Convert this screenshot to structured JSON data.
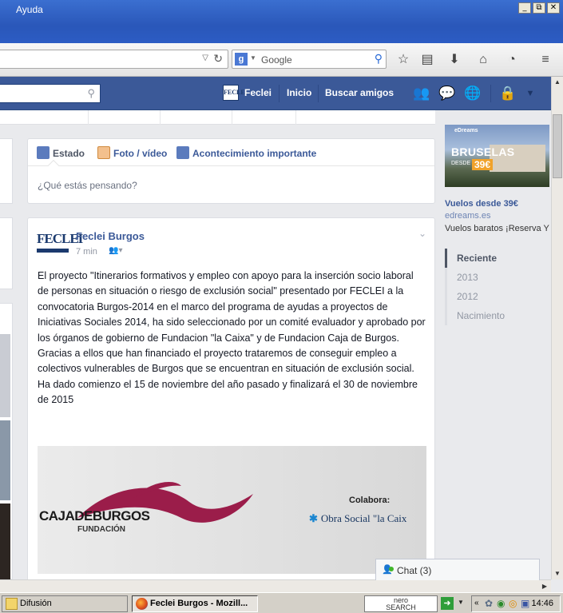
{
  "browser": {
    "menu": {
      "first_fragment": "",
      "help": "Ayuda"
    },
    "window_buttons": [
      "_",
      "⧉",
      "✕"
    ],
    "search": {
      "engine_letter": "g",
      "placeholder": "Google"
    }
  },
  "facebook": {
    "topbar": {
      "page_name": "Feclei",
      "home": "Inicio",
      "find_friends": "Buscar amigos"
    },
    "composer": {
      "tabs": [
        {
          "label": "Estado"
        },
        {
          "label": "Foto / vídeo"
        },
        {
          "label": "Acontecimiento importante"
        }
      ],
      "placeholder": "¿Qué estás pensando?"
    },
    "post": {
      "logo_text": "FECLEI",
      "author": "Feclei Burgos",
      "time": "7 min",
      "body": [
        "El proyecto \"Itinerarios formativos y empleo con apoyo para la inserción socio laboral de personas en situación o riesgo de exclusión social\" presentado por FECLEI a la convocatoria Burgos-2014 en el marco del programa de ayudas a proyectos de Iniciativas Sociales 2014, ha sido seleccionado por un comité evaluador y aprobado por los órganos de gobierno de Fundacion \"la Caixa\" y de Fundacion Caja de Burgos.",
        "Gracias a ellos que han financiado el proyecto trataremos de conseguir empleo a colectivos vulnerables de Burgos que se encuentran en situación de exclusión social.",
        "Ha dado comienzo el 15 de noviembre del año pasado y finalizará el 30 de noviembre de 2015"
      ],
      "image": {
        "cajaburgos": "CAJADEBURGOS",
        "fundacion": "FUNDACIÓN",
        "colabora": "Colabora:",
        "obra_social": "Obra Social \"la Caix"
      }
    },
    "ad": {
      "brand": "eDreams",
      "city": "BRUSELAS",
      "desde": "DESDE",
      "price": "39€",
      "title": "Vuelos desde 39€",
      "url": "edreams.es",
      "description": "Vuelos baratos ¡Reserva Y"
    },
    "timeline": [
      "Reciente",
      "2013",
      "2012",
      "Nacimiento"
    ],
    "chat": {
      "label": "Chat (3)"
    }
  },
  "taskbar": {
    "tasks": [
      {
        "label": "Difusión"
      },
      {
        "label": "Feclei Burgos - Mozill..."
      }
    ],
    "nero_top": "nero",
    "nero_bottom": "SEARCH",
    "clock": "14:46"
  },
  "colors": {
    "facebook_blue": "#3b5998",
    "link": "#3b5998",
    "titlebar": "#2a57b9",
    "online": "#42b72a"
  }
}
